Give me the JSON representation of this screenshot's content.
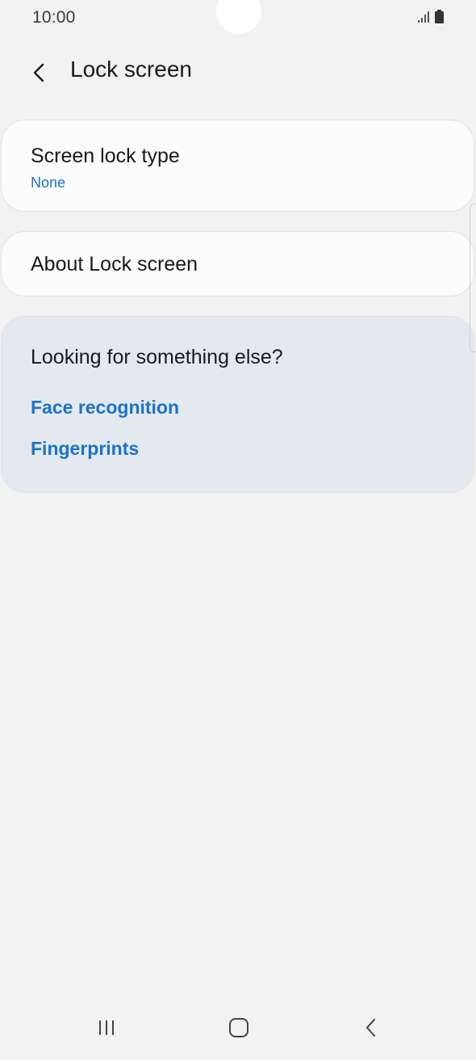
{
  "status_bar": {
    "time": "10:00",
    "icons": [
      "signal-icon",
      "battery-icon"
    ]
  },
  "header": {
    "back_icon": "chevron-left-icon",
    "title": "Lock screen"
  },
  "settings": {
    "screen_lock_type": {
      "title": "Screen lock type",
      "value": "None"
    },
    "about": {
      "title": "About Lock screen"
    }
  },
  "suggestions": {
    "heading": "Looking for something else?",
    "links": [
      "Face recognition",
      "Fingerprints"
    ]
  },
  "nav_bar": {
    "icons": [
      "recent-apps-icon",
      "home-icon",
      "back-icon"
    ]
  },
  "colors": {
    "background": "#f2f2f2",
    "card": "#fcfcfc",
    "suggestion_card": "#e4e9f0",
    "accent": "#1a73c9",
    "text": "#1a1a1a"
  }
}
